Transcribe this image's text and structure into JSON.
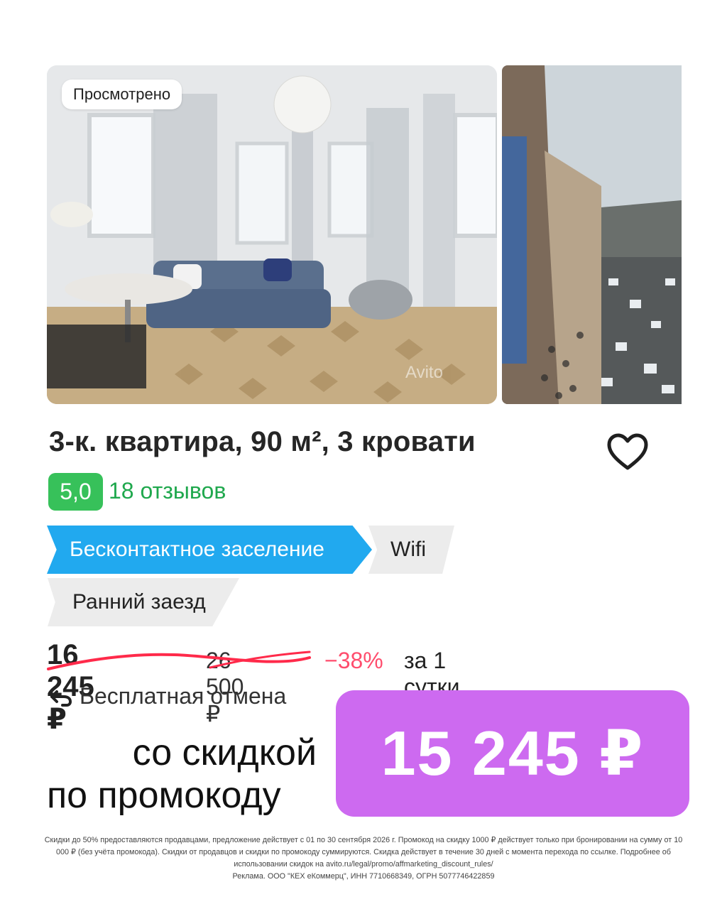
{
  "gallery": {
    "viewed_label": "Просмотрено",
    "watermark": "Avito"
  },
  "listing": {
    "title": "3-к. квартира, 90 м², 3 кровати",
    "rating": "5,0",
    "reviews": "18 отзывов",
    "tags": [
      "Бесконтактное заселение",
      "Wifi",
      "Ранний заезд"
    ]
  },
  "price": {
    "current": "16 245 ₽",
    "old": "26 500 ₽",
    "discount": "−38%",
    "period": "за 1 сутки"
  },
  "cancel": {
    "label": "Бесплатная отмена"
  },
  "promo": {
    "line1": "со скидкой",
    "line2": "по промокоду",
    "price": "15 245 ₽"
  },
  "disclaimer": {
    "text": "Скидки до 50% предоставляются продавцами, предложение действует с 01 по 30 сентября 2026 г. Промокод на скидку 1000 ₽ действует только при бронировании на сумму от 10 000 ₽ (без учёта промокода). Скидки от продавцов и скидки по промокоду суммируются. Скидка действует в течение 30 дней с момента перехода по ссылке. Подробнее об использовании скидок на avito.ru/legal/promo/affmarketing_discount_rules/",
    "ad": "Реклама. ООО \"КЕХ еКоммерц\", ИНН 7710668349, ОГРН 5077746422859"
  },
  "colors": {
    "rating_green": "#37c15a",
    "tag_blue": "#21a9ef",
    "discount_red": "#ff4d6d",
    "promo_purple": "#cd6af0"
  },
  "icons": [
    "heart-icon",
    "undo-arrow-icon"
  ]
}
